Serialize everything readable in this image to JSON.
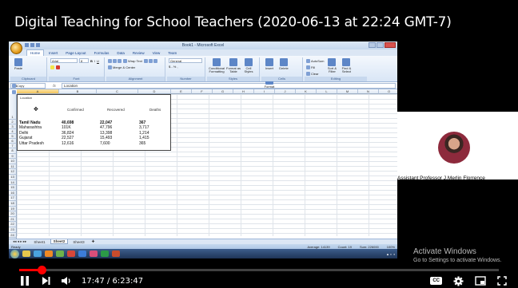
{
  "video": {
    "title": "Digital Teaching for School Teachers (2020-06-13 at 22:24 GMT-7)"
  },
  "excel": {
    "window_title": "Book1 - Microsoft Excel",
    "tabs": [
      "Home",
      "Insert",
      "Page Layout",
      "Formulas",
      "Data",
      "Review",
      "View",
      "Team"
    ],
    "active_tab": "Home",
    "ribbon": {
      "clipboard": {
        "label": "Clipboard",
        "paste": "Paste",
        "cut": "Cut",
        "copy": "Copy",
        "format_painter": "Format Painter"
      },
      "font": {
        "label": "Font",
        "name": "Arial",
        "size": "8"
      },
      "alignment": {
        "label": "Alignment",
        "wrap": "Wrap Text",
        "merge": "Merge & Center"
      },
      "number": {
        "label": "Number",
        "format": "General"
      },
      "styles": {
        "label": "Styles",
        "conditional": "Conditional Formatting",
        "format_table": "Format as Table",
        "cell_styles": "Cell Styles"
      },
      "cells": {
        "label": "Cells",
        "insert": "Insert",
        "delete": "Delete",
        "format": "Format"
      },
      "editing": {
        "label": "Editing",
        "autosum": "AutoSum",
        "fill": "Fill",
        "clear": "Clear",
        "sort": "Sort & Filter",
        "find": "Find & Select"
      }
    },
    "name_box": "A1",
    "fx": "fx",
    "formula_value": "Location",
    "columns": [
      "A",
      "B",
      "C",
      "D",
      "E",
      "F",
      "G",
      "H",
      "I",
      "J",
      "K",
      "L",
      "M",
      "N",
      "O",
      "P",
      "Q"
    ],
    "rows": [
      "1",
      "2",
      "3",
      "4",
      "5",
      "6",
      "7",
      "8",
      "9",
      "10",
      "11",
      "12",
      "13",
      "14",
      "15",
      "16",
      "17",
      "18",
      "19",
      "20",
      "21",
      "22",
      "23",
      "24",
      "25"
    ],
    "table": {
      "corner_label": "Location",
      "headers": [
        "Confirmed",
        "Recovered",
        "Deaths"
      ],
      "data": [
        [
          "Tamil Nadu",
          "40,698",
          "22,047",
          "367"
        ],
        [
          "Maharashtra",
          "101K",
          "47,796",
          "3,717"
        ],
        [
          "Delhi",
          "36,824",
          "13,398",
          "1,214"
        ],
        [
          "Gujarat",
          "22,527",
          "15,493",
          "1,415"
        ],
        [
          "Uttar Pradesh",
          "12,616",
          "7,600",
          "365"
        ]
      ]
    },
    "sheets": [
      "Sheet1",
      "Sheet2",
      "Sheet3"
    ],
    "active_sheet": "Sheet2",
    "status": {
      "ready": "Ready",
      "average": "Average: 14139",
      "count": "Count: 19",
      "sum": "Sum: 226000",
      "zoom": "100%"
    }
  },
  "presenter": {
    "name": "Assistant Professor J.Merlin Florrence"
  },
  "watermark": {
    "line1": "Activate Windows",
    "line2": "Go to Settings to activate Windows."
  },
  "player": {
    "current_time": "17:47",
    "duration": "6:23:47",
    "time_display": "17:47 / 6:23:47",
    "played_fraction": 0.0463,
    "loaded_fraction": 0.055,
    "cc_label": "CC",
    "icons": [
      "pause-icon",
      "next-icon",
      "volume-icon",
      "captions-icon",
      "settings-gear-icon",
      "miniplayer-icon",
      "fullscreen-icon"
    ]
  }
}
